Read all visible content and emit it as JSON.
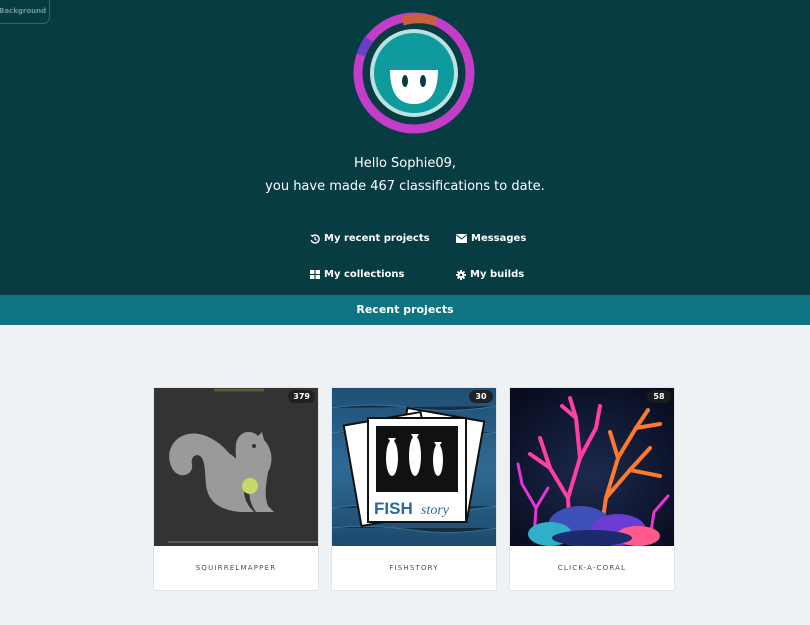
{
  "header": {
    "background_button": "Background",
    "greeting_line1": "Hello Sophie09,",
    "greeting_line2": "you have made 467 classifications to date."
  },
  "nav": {
    "recent_projects": "My recent projects",
    "messages": "Messages",
    "collections": "My collections",
    "builds": "My builds"
  },
  "section": {
    "title": "Recent projects"
  },
  "projects": [
    {
      "name": "SQUIRRELMAPPER",
      "count": "379"
    },
    {
      "name": "FISHSTORY",
      "count": "30"
    },
    {
      "name": "CLICK-A-CORAL",
      "count": "58"
    }
  ],
  "colors": {
    "hero_bg": "#063c42",
    "section_bar": "#0f7381",
    "ring_primary": "#c33dc9",
    "ring_orange": "#c8613b",
    "ring_purple": "#6a3fc8",
    "avatar_face": "#0f9a9e"
  },
  "icons": {
    "recent_projects": "history-icon",
    "messages": "envelope-icon",
    "collections": "grid-icon",
    "builds": "gear-icon"
  }
}
